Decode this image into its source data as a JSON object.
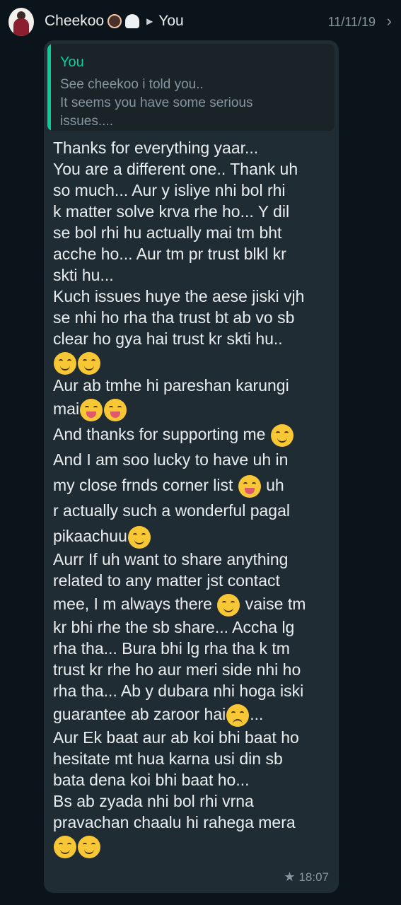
{
  "header": {
    "sender": "Cheekoo",
    "recipient": "You",
    "date": "11/11/19"
  },
  "quote": {
    "author": "You",
    "line1": "See cheekoo i told you..",
    "line2": "It seems you have some serious",
    "line3": "issues...."
  },
  "message": {
    "l1": "Thanks for everything yaar...",
    "l2": "You are a different one.. Thank uh",
    "l3": "so much... Aur y isliye nhi bol rhi",
    "l4": "k matter solve krva rhe ho... Y dil",
    "l5": "se bol rhi hu actually mai tm bht",
    "l6": "acche ho... Aur tm pr trust blkl kr",
    "l7": "skti hu...",
    "l8": "Kuch issues huye the aese jiski vjh",
    "l9": "se nhi ho rha tha trust bt ab vo sb",
    "l10": "clear ho gya hai  trust kr skti hu..",
    "l11": "Aur ab tmhe hi pareshan karungi",
    "l12": "mai",
    "l13": "And thanks for supporting me",
    "l14": "And I am soo lucky to have uh in",
    "l15a": "my close frnds corner list",
    "l15b": "uh",
    "l16": "r actually such a wonderful pagal",
    "l17": "pikaachuu",
    "l18": "Aurr If uh want to share anything",
    "l19": "related to any matter jst contact",
    "l20a": "mee, I m always there",
    "l20b": "vaise tm",
    "l21": "kr bhi rhe the sb share... Accha lg",
    "l22": "rha tha... Bura bhi lg rha tha k tm",
    "l23": "trust kr rhe ho aur meri side nhi ho",
    "l24": "rha tha... Ab y dubara nhi hoga iski",
    "l25a": "guarantee ab zaroor hai",
    "l25b": "...",
    "l26": "Aur Ek baat aur ab koi bhi baat ho",
    "l27": "hesitate mt hua karna usi din sb",
    "l28": "bata dena koi bhi baat ho...",
    "l29": "Bs ab zyada nhi bol rhi vrna",
    "l30": "pravachan chaalu hi rahega mera"
  },
  "time": "18:07",
  "icons": {
    "star": "star-icon",
    "chevron": "chevron-right-icon"
  },
  "colors": {
    "background": "#0b141a",
    "bubble": "#202c33",
    "accent": "#06cf9c",
    "muted": "#8696a0"
  }
}
